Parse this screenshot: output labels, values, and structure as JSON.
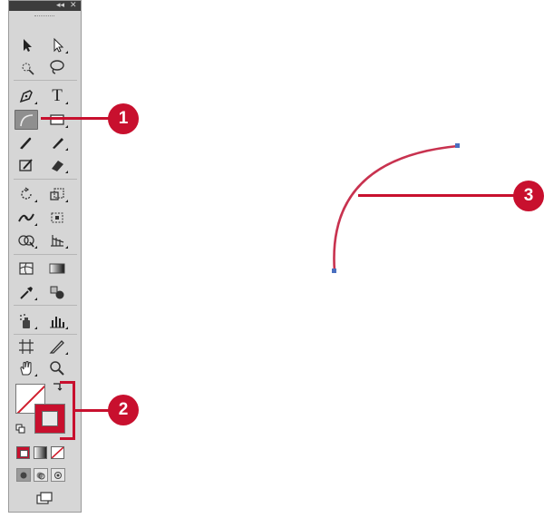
{
  "panel": {
    "collapse_glyph": "◂◂",
    "close_glyph": "✕",
    "tools": [
      {
        "name": "selection-tool-icon"
      },
      {
        "name": "direct-selection-tool-icon"
      },
      {
        "name": "magic-wand-tool-icon"
      },
      {
        "name": "lasso-tool-icon"
      },
      {
        "name": "pen-tool-icon"
      },
      {
        "name": "type-tool-icon",
        "glyph": "T"
      },
      {
        "name": "arc-tool-icon",
        "active": true
      },
      {
        "name": "rectangle-tool-icon"
      },
      {
        "name": "paintbrush-tool-icon"
      },
      {
        "name": "pencil-tool-icon"
      },
      {
        "name": "blob-brush-tool-icon"
      },
      {
        "name": "eraser-tool-icon"
      },
      {
        "name": "rotate-tool-icon"
      },
      {
        "name": "scale-tool-icon"
      },
      {
        "name": "width-tool-icon"
      },
      {
        "name": "free-transform-tool-icon"
      },
      {
        "name": "shape-builder-tool-icon"
      },
      {
        "name": "perspective-grid-tool-icon"
      },
      {
        "name": "mesh-tool-icon"
      },
      {
        "name": "gradient-tool-icon"
      },
      {
        "name": "eyedropper-tool-icon"
      },
      {
        "name": "blend-tool-icon"
      },
      {
        "name": "symbol-sprayer-tool-icon"
      },
      {
        "name": "column-graph-tool-icon"
      },
      {
        "name": "artboard-tool-icon"
      },
      {
        "name": "slice-tool-icon"
      },
      {
        "name": "hand-tool-icon"
      },
      {
        "name": "zoom-tool-icon"
      }
    ],
    "stroke_color": "#c8102e"
  },
  "callouts": {
    "one": "1",
    "two": "2",
    "three": "3"
  },
  "colors": {
    "accent": "#c8102e",
    "arc_stroke": "#c8324f",
    "anchor": "#4a6fc0"
  }
}
